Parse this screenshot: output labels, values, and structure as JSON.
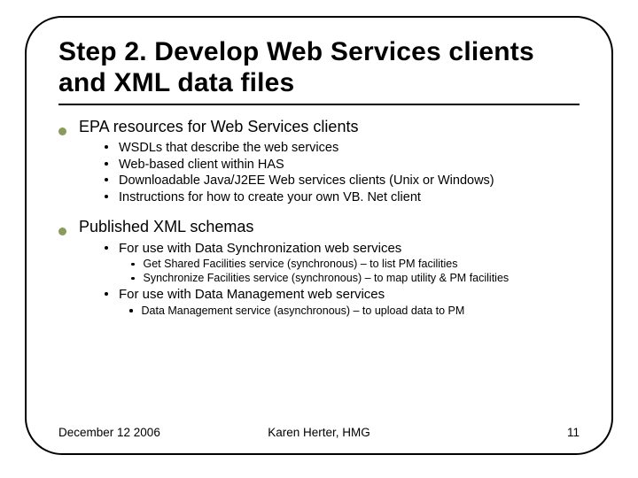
{
  "title": "Step 2. Develop Web Services clients and XML data files",
  "sections": [
    {
      "heading": "EPA resources for Web Services clients",
      "items": [
        "WSDLs that describe the web services",
        "Web-based client within HAS",
        "Downloadable Java/J2EE Web services clients (Unix or Windows)",
        "Instructions for how to create your own VB. Net client"
      ]
    },
    {
      "heading": "Published XML schemas",
      "subs": [
        {
          "label": "For use with Data Synchronization web services",
          "details": [
            "Get Shared Facilities service (synchronous) – to list PM facilities",
            "Synchronize Facilities service (synchronous) – to map utility & PM facilities"
          ]
        },
        {
          "label": "For use with Data Management web services",
          "details": [
            "Data Management service (asynchronous) – to upload data to PM"
          ]
        }
      ]
    }
  ],
  "footer": {
    "date": "December 12 2006",
    "author": "Karen Herter, HMG",
    "page": "11"
  }
}
